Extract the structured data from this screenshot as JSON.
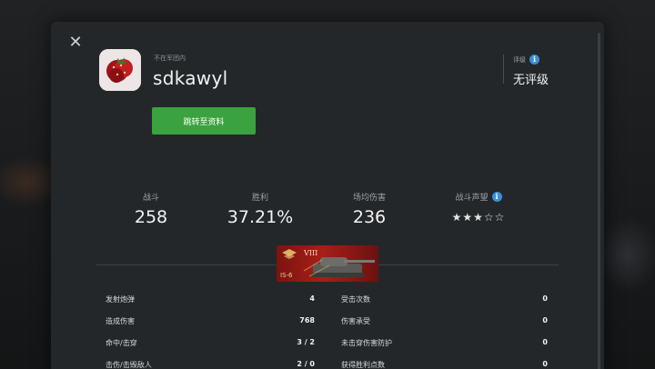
{
  "modal": {
    "clan_status": "不在军团内",
    "player_name": "sdkawyl",
    "profile_button": "跳转至资料",
    "rating": {
      "label": "评级",
      "value": "无评级"
    }
  },
  "summary": [
    {
      "label": "战斗",
      "value": "258"
    },
    {
      "label": "胜利",
      "value": "37.21%"
    },
    {
      "label": "场均伤害",
      "value": "236"
    },
    {
      "label": "战斗声望",
      "value": "★★★☆☆",
      "stars": 3,
      "max_stars": 5
    }
  ],
  "tank": {
    "tier": "VIII",
    "name": "IS-6"
  },
  "stats_table": [
    {
      "left_label": "发射炮弹",
      "left_value": "4",
      "right_label": "受击次数",
      "right_value": "0"
    },
    {
      "left_label": "造成伤害",
      "left_value": "768",
      "right_label": "伤害承受",
      "right_value": "0"
    },
    {
      "left_label": "命中/击穿",
      "left_value": "3 / 2",
      "right_label": "未击穿伤害防护",
      "right_value": "0"
    },
    {
      "left_label": "击伤/击毁敌人",
      "left_value": "2 / 0",
      "right_label": "获得胜利点数",
      "right_value": "0"
    }
  ],
  "colors": {
    "profile_button": "#3aa23e",
    "info_icon": "#3a8fd6",
    "tank_banner": "#a81e18"
  }
}
